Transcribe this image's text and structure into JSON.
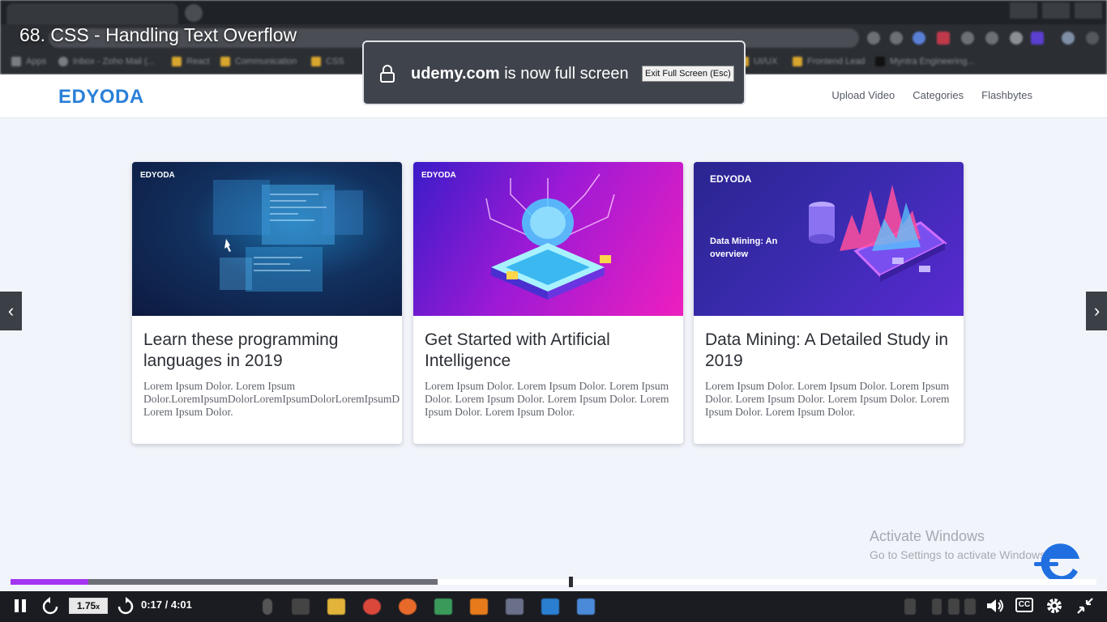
{
  "video": {
    "title": "68. CSS - Handling Text Overflow",
    "speed": "1.75",
    "speed_suffix": "x",
    "time": "0:17 / 4:01",
    "progress": {
      "played_fraction": 0.072,
      "buffered_fraction": 0.393,
      "marker_fraction": 0.514
    }
  },
  "browser": {
    "bookmarks": [
      "Apps",
      "Inbox - Zoho Mail (...",
      "React",
      "Communication",
      "CSS",
      "UI/UX",
      "Frontend Lead",
      "Myntra Engineering..."
    ]
  },
  "fullscreen_notice": {
    "domain": "udemy.com",
    "message": " is now full screen",
    "exit_label": "Exit Full Screen (Esc)"
  },
  "site": {
    "logo": "EDYODA",
    "nav": [
      "Upload Video",
      "Categories",
      "Flashbytes"
    ]
  },
  "cards": [
    {
      "brand": "EDYODA",
      "title": "Learn these programming languages in 2019",
      "text_line1": "Lorem Ipsum Dolor. Lorem Ipsum",
      "text_line2": "Dolor.LoremIpsumDolorLoremIpsumDolorLoremIpsumD",
      "text_line3": "Lorem Ipsum Dolor."
    },
    {
      "brand": "EDYODA",
      "title": "Get Started with Artificial Intelligence",
      "text": "Lorem Ipsum Dolor. Lorem Ipsum Dolor. Lorem Ipsum Dolor. Lorem Ipsum Dolor. Lorem Ipsum Dolor. Lorem Ipsum Dolor. Lorem Ipsum Dolor."
    },
    {
      "brand": "EDYODA",
      "image_caption": "Data Mining: An overview",
      "title": "Data Mining: A Detailed Study in 2019",
      "text": "Lorem Ipsum Dolor. Lorem Ipsum Dolor. Lorem Ipsum Dolor. Lorem Ipsum Dolor. Lorem Ipsum Dolor. Lorem Ipsum Dolor. Lorem Ipsum Dolor."
    }
  ],
  "watermark": {
    "line1": "Activate Windows",
    "line2": "Go to Settings to activate Windows."
  },
  "icons": {
    "prev": "‹",
    "next": "›",
    "cc": "CC"
  },
  "colors": {
    "accent": "#a435f0",
    "logo": "#2a80d8"
  }
}
